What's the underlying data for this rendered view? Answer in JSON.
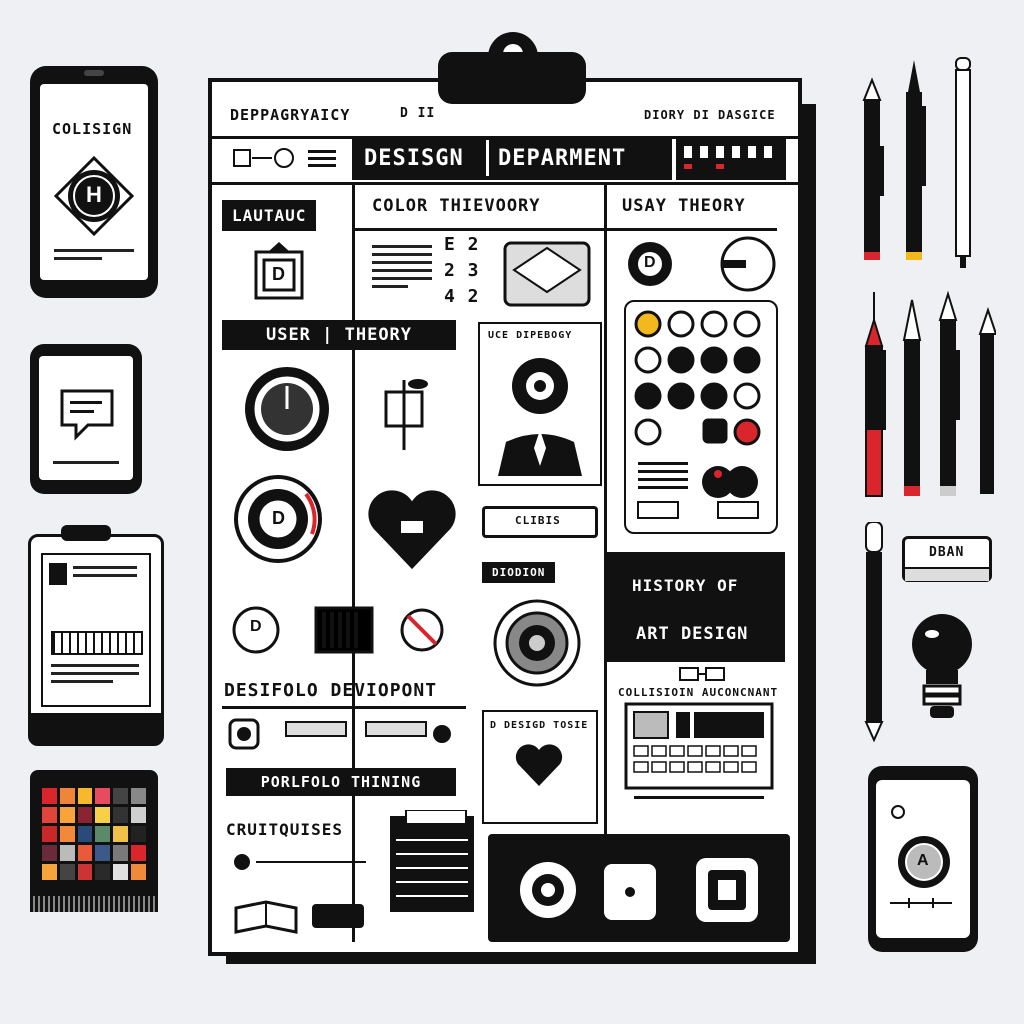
{
  "colors": {
    "ink": "#111111",
    "paper": "#ffffff",
    "bg": "#eef0f4",
    "red": "#d8262c",
    "yellow": "#f2b81e"
  },
  "board": {
    "top_left_label": "DEPPAGRYAICY",
    "top_mid_label": "D  II",
    "top_right_label": "DIORY DI DASGICE",
    "title_left": "DESISGN",
    "title_right": "DEPARMENT",
    "lautauc": "LAUTAUC",
    "color_theory": "COLOR THIEVOORY",
    "usay_theory": "USAY THEORY",
    "user_theory": "USER  |  THEORY",
    "d_letter": "D",
    "numbers": [
      "E 2",
      "2 3",
      "4 2"
    ],
    "uce_label": "UCE DIPEBOGY",
    "clibis": "CLIBIS",
    "diodion": "DIODION",
    "history": "HISTORY OF",
    "art_design": "ART  DESIGN",
    "desifolo": "DESIFOLO DEVIOPONT",
    "porlfolo": "PORLFOLO THINING",
    "crutiquises": "CRUITQUISES",
    "design_tosie": "D DESIGD TOSIE",
    "collision": "COLLISIOIN AUCONCNANT"
  },
  "left_devices": {
    "phone_label": "COLISIGN",
    "phone_glyph": "H",
    "palette_colors": [
      "#d8262c",
      "#f0853a",
      "#f7b82e",
      "#e84a5f",
      "#444",
      "#888",
      "#e0443a",
      "#f7a43a",
      "#8a2432",
      "#f7d04a",
      "#333",
      "#cfcfcf",
      "#c82828",
      "#f08a3a",
      "#2a4a7a",
      "#5a8a6a",
      "#f0c04a",
      "#222",
      "#6a2a3a",
      "#bbb",
      "#e85a3a",
      "#3a5a8a",
      "#7a7a7a",
      "#d8262c",
      "#f7a43a",
      "#444",
      "#cc3333",
      "#2a2a2a",
      "#e0e0e0",
      "#f08a3a"
    ]
  },
  "right_tools": {
    "eraser_label": "DBAN",
    "phone_glyph": "A"
  }
}
